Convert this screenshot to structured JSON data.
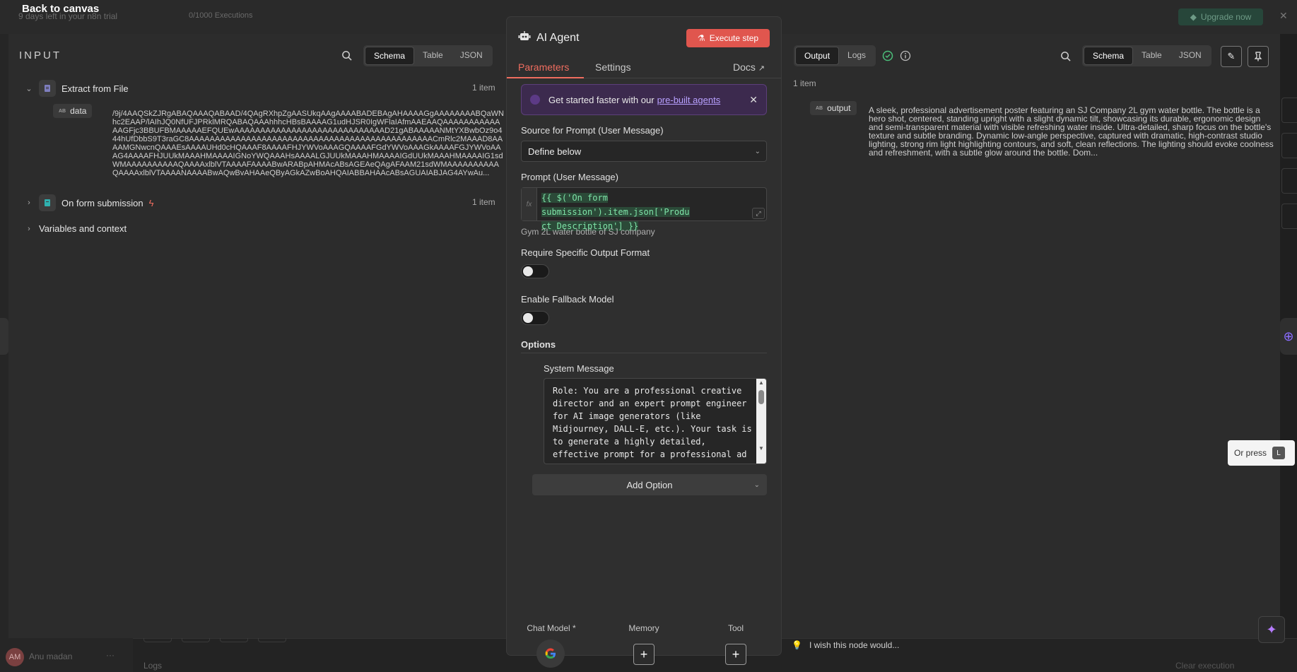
{
  "background": {
    "trial_text": "9 days left in your n8n trial",
    "executions": "0/1000 Executions",
    "upgrade_label": "Upgrade now",
    "user_initials": "AM",
    "user_name": "Anu madan",
    "logs_label": "Logs",
    "clear_execution": "Clear execution"
  },
  "back_to_canvas": "Back to canvas",
  "input": {
    "title": "INPUT",
    "view_tabs": [
      "Schema",
      "Table",
      "JSON"
    ],
    "active_view": "Schema",
    "nodes": [
      {
        "name": "Extract from File",
        "count": "1 item"
      },
      {
        "name": "On form submission",
        "count": "1 item"
      },
      {
        "name": "Variables and context"
      }
    ],
    "field": {
      "name": "data",
      "value": "/9j/4AAQSkZJRgABAQAAAQABAAD/4QAgRXhpZgAASUkqAAgAAAABADEBAgAHAAAAGgAAAAAAAABQaWNhc2EAAP/lAIhJQ0NfUFJPRklMRQABAQAAAhhhcHBsBAAAAG1udHJSR0IgWFlaIAfmAAEAAQAAAAAAAAAAAAAGFjc3BBUFBMAAAAAEFQUEwAAAAAAAAAAAAAAAAAAAAAAAAAAAAAD21gABAAAAANMtYXBwbOz9o444hUfDbbS9T3raGC8AAAAAAAAAAAAAAAAAAAAAAAAAAAAAAAAAAAAAAAAAAAAAAACmRlc2MAAAD8AAAAMGNwcnQAAAEsAAAAUHd0cHQAAAF8AAAAFHJYWVoAAAGQAAAAFGdYWVoAAAGkAAAAFGJYWVoAAAG4AAAAFHJUUkMAAAHMAAAAIGNoYWQAAAHsAAAALGJUUkMAAAHMAAAAIGdUUkMAAAHMAAAAIG1sdWMAAAAAAAAAAQAAAAxlblVTAAAAFAAAABwARABpAHMAcABsAGEAeQAgAFAAM21sdWMAAAAAAAAAAQAAAAxlblVTAAAANAAAABwAQwBvAHAAeQByAGkAZwBoAHQAIABBAHAAcABsAGUAIABJAG4AYwAu..."
    }
  },
  "node": {
    "title": "AI Agent",
    "execute_label": "Execute step",
    "tabs": {
      "parameters": "Parameters",
      "settings": "Settings",
      "docs": "Docs"
    },
    "banner": {
      "text": "Get started faster with our",
      "link": "pre-built agents"
    },
    "source_label": "Source for Prompt (User Message)",
    "source_value": "Define below",
    "prompt_label": "Prompt (User Message)",
    "prompt_expression_line1": "{{ $('On form submission').item.json['Produ",
    "prompt_expression_line2": "ct Description'] }}",
    "prompt_hint": "Gym 2L water bottle of SJ company",
    "require_format_label": "Require Specific Output Format",
    "require_format_on": false,
    "fallback_label": "Enable Fallback Model",
    "fallback_on": false,
    "options_label": "Options",
    "system_message_label": "System Message",
    "system_message": "Role: You are a professional creative director and an expert prompt engineer for AI image generators (like Midjourney, DALL-E, etc.). Your task is to generate a highly detailed, effective prompt for a professional ad",
    "add_option_label": "Add Option",
    "sub_nodes": {
      "chat_model": "Chat Model *",
      "memory": "Memory",
      "tool": "Tool"
    }
  },
  "output": {
    "tabs": [
      "Output",
      "Logs"
    ],
    "active_tab": "Output",
    "view_tabs": [
      "Schema",
      "Table",
      "JSON"
    ],
    "active_view": "Schema",
    "item_count": "1 item",
    "field_name": "output",
    "field_value": "A sleek, professional advertisement poster featuring an SJ Company 2L gym water bottle. The bottle is a hero shot, centered, standing upright with a slight dynamic tilt, showcasing its durable, ergonomic design and semi-transparent material with visible refreshing water inside. Ultra-detailed, sharp focus on the bottle's texture and subtle branding. Dynamic low-angle perspective, captured with dramatic, high-contrast studio lighting, strong rim light highlighting contours, and soft, clean reflections. The lighting should evoke coolness and refreshment, with a subtle glow around the bottle. Dom...",
    "wish_text": "I wish this node would..."
  },
  "tooltip": {
    "text": "Or press",
    "key": "L"
  },
  "colors": {
    "accent": "#ef6d5f",
    "execute": "#e0564e",
    "success": "#4bbf7a",
    "code": "#7fe4a8"
  }
}
